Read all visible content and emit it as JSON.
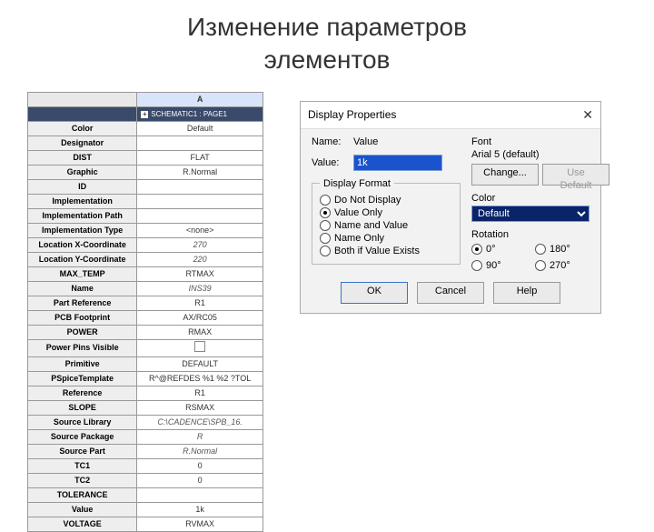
{
  "title_line1": "Изменение параметров",
  "title_line2": "элементов",
  "table": {
    "col_header": "A",
    "sub_header": "SCHEMATIC1 : PAGE1",
    "rows": [
      {
        "name": "Color",
        "value": "Default",
        "italic": false
      },
      {
        "name": "Designator",
        "value": "",
        "italic": false
      },
      {
        "name": "DIST",
        "value": "FLAT",
        "italic": false
      },
      {
        "name": "Graphic",
        "value": "R.Normal",
        "italic": false
      },
      {
        "name": "ID",
        "value": "",
        "italic": false
      },
      {
        "name": "Implementation",
        "value": "",
        "italic": false
      },
      {
        "name": "Implementation Path",
        "value": "",
        "italic": false
      },
      {
        "name": "Implementation Type",
        "value": "<none>",
        "italic": false
      },
      {
        "name": "Location X-Coordinate",
        "value": "270",
        "italic": true
      },
      {
        "name": "Location Y-Coordinate",
        "value": "220",
        "italic": true
      },
      {
        "name": "MAX_TEMP",
        "value": "RTMAX",
        "italic": false
      },
      {
        "name": "Name",
        "value": "INS39",
        "italic": true
      },
      {
        "name": "Part Reference",
        "value": "R1",
        "italic": false
      },
      {
        "name": "PCB Footprint",
        "value": "AX/RC05",
        "italic": false
      },
      {
        "name": "POWER",
        "value": "RMAX",
        "italic": false
      },
      {
        "name": "Power Pins Visible",
        "value": "__CHECK__",
        "italic": false
      },
      {
        "name": "Primitive",
        "value": "DEFAULT",
        "italic": false
      },
      {
        "name": "PSpiceTemplate",
        "value": "R^@REFDES %1 %2 ?TOL",
        "italic": false
      },
      {
        "name": "Reference",
        "value": "R1",
        "italic": false
      },
      {
        "name": "SLOPE",
        "value": "RSMAX",
        "italic": false
      },
      {
        "name": "Source Library",
        "value": "C:\\CADENCE\\SPB_16.",
        "italic": true
      },
      {
        "name": "Source Package",
        "value": "R",
        "italic": true
      },
      {
        "name": "Source Part",
        "value": "R.Normal",
        "italic": true
      },
      {
        "name": "TC1",
        "value": "0",
        "italic": false
      },
      {
        "name": "TC2",
        "value": "0",
        "italic": false
      },
      {
        "name": "TOLERANCE",
        "value": "",
        "italic": false
      },
      {
        "name": "Value",
        "value": "1k",
        "italic": false
      },
      {
        "name": "VOLTAGE",
        "value": "RVMAX",
        "italic": false
      }
    ]
  },
  "dialog": {
    "title": "Display Properties",
    "name_label": "Name:",
    "name_value": "Value",
    "value_label": "Value:",
    "value_field": "1k",
    "display_format_legend": "Display Format",
    "fmt_do_not": "Do Not Display",
    "fmt_value_only": "Value Only",
    "fmt_name_value": "Name and Value",
    "fmt_name_only": "Name Only",
    "fmt_both_if": "Both if Value Exists",
    "font_group": "Font",
    "font_name": "Arial 5 (default)",
    "change_btn": "Change...",
    "use_default_btn": "Use Default",
    "color_group": "Color",
    "color_value": "Default",
    "rotation_group": "Rotation",
    "rot_0": "0°",
    "rot_90": "90°",
    "rot_180": "180°",
    "rot_270": "270°",
    "ok": "OK",
    "cancel": "Cancel",
    "help": "Help"
  }
}
